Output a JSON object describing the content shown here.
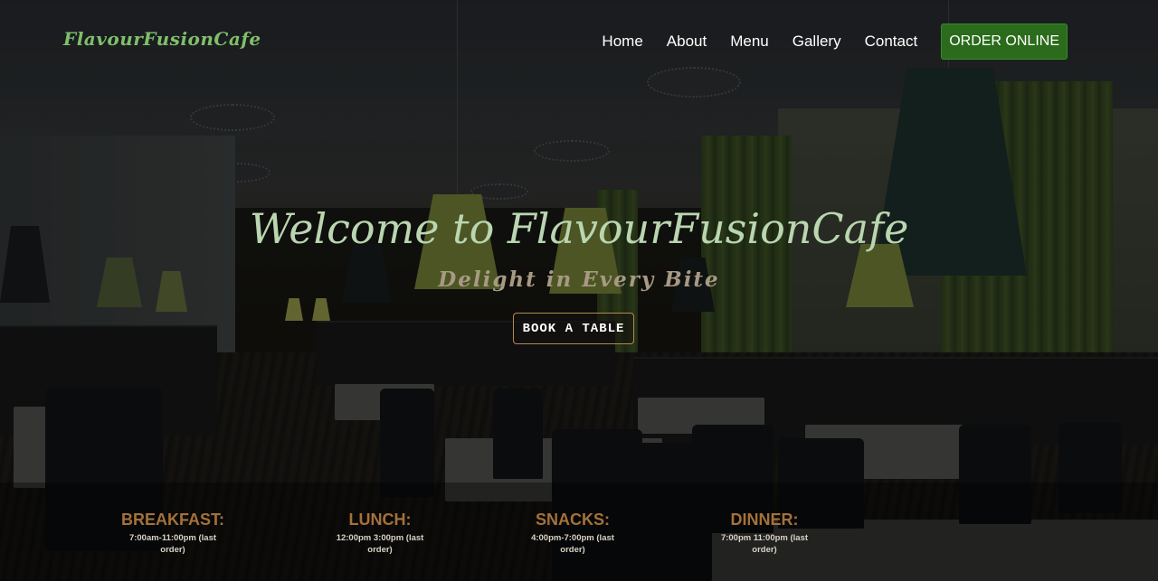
{
  "brand": {
    "logo_text": "FlavourFusionCafe"
  },
  "nav": {
    "items": [
      "Home",
      "About",
      "Menu",
      "Gallery",
      "Contact"
    ],
    "order_button": "ORDER ONLINE"
  },
  "hero": {
    "welcome": "Welcome to FlavourFusionCafe",
    "tagline": "Delight in Every Bite",
    "book_button": "BOOK A TABLE"
  },
  "hours": [
    {
      "name": "BREAKFAST:",
      "time": "7:00am-11:00pm (last order)"
    },
    {
      "name": "LUNCH:",
      "time": "12:00pm 3:00pm (last order)"
    },
    {
      "name": "SNACKS:",
      "time": "4:00pm-7:00pm (last order)"
    },
    {
      "name": "DINNER:",
      "time": "7:00pm 11:00pm (last order)"
    }
  ],
  "colors": {
    "logo": "#7fbf6a",
    "order_button_bg": "#2a6b1c",
    "welcome_text": "#b9d6b0",
    "tagline_text": "#a79a83",
    "meal_label": "#a4713a",
    "book_button_border": "#b28a4f"
  }
}
